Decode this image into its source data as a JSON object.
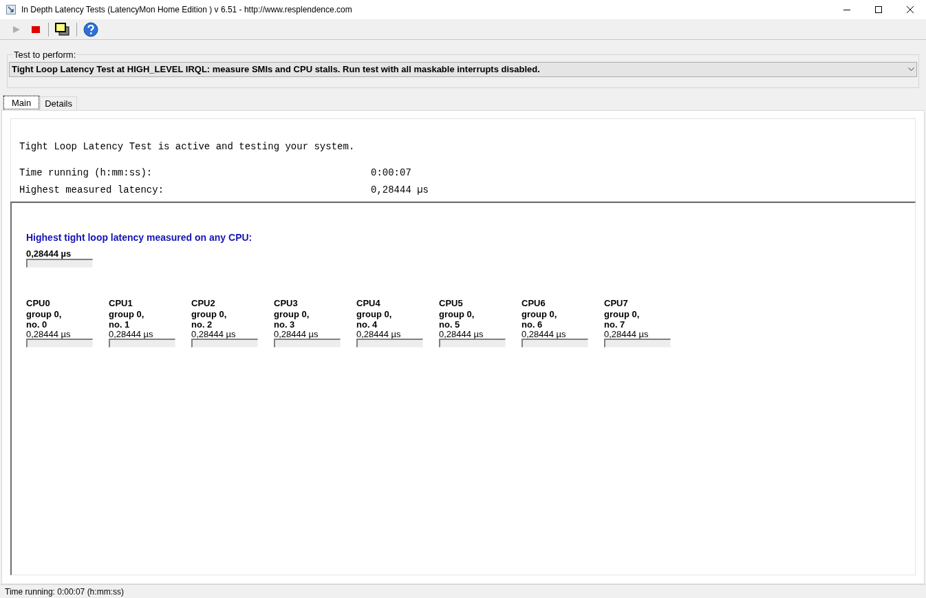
{
  "window": {
    "title": "In Depth Latency Tests  (LatencyMon Home Edition )  v 6.51 - http://www.resplendence.com"
  },
  "toolbar": [
    {
      "kind": "play",
      "disabled": true
    },
    {
      "kind": "stop",
      "disabled": false
    },
    {
      "kind": "windows",
      "disabled": false
    },
    {
      "kind": "help",
      "disabled": false
    }
  ],
  "test_group": {
    "label": "Test to perform:",
    "value": "Tight Loop Latency Test at HIGH_LEVEL IRQL:  measure SMIs and CPU stalls. Run test with all maskable interrupts disabled."
  },
  "tabs": [
    {
      "label": "Main",
      "selected": true
    },
    {
      "label": "Details",
      "selected": false
    }
  ],
  "status_panel": {
    "message": "Tight Loop Latency Test is active and testing your system.",
    "rows": [
      {
        "label": "Time running (h:mm:ss):",
        "value": "0:00:07"
      },
      {
        "label": "Highest measured latency:",
        "value": "0,28444 µs"
      }
    ]
  },
  "overall": {
    "title": "Highest tight loop latency measured on any CPU:",
    "value": "0,28444 µs",
    "level": 0
  },
  "cpus": [
    {
      "name": "CPU0",
      "group": "group 0,",
      "number": "no. 0",
      "value": "0,28444 µs",
      "level": 0
    },
    {
      "name": "CPU1",
      "group": "group 0,",
      "number": "no. 1",
      "value": "0,28444 µs",
      "level": 0
    },
    {
      "name": "CPU2",
      "group": "group 0,",
      "number": "no. 2",
      "value": "0,28444 µs",
      "level": 0
    },
    {
      "name": "CPU3",
      "group": "group 0,",
      "number": "no. 3",
      "value": "0,28444 µs",
      "level": 0
    },
    {
      "name": "CPU4",
      "group": "group 0,",
      "number": "no. 4",
      "value": "0,28444 µs",
      "level": 0
    },
    {
      "name": "CPU5",
      "group": "group 0,",
      "number": "no. 5",
      "value": "0,28444 µs",
      "level": 0
    },
    {
      "name": "CPU6",
      "group": "group 0,",
      "number": "no. 6",
      "value": "0,28444 µs",
      "level": 0
    },
    {
      "name": "CPU7",
      "group": "group 0,",
      "number": "no. 7",
      "value": "0,28444 µs",
      "level": 0
    }
  ],
  "status_bar": "Time running: 0:00:07  (h:mm:ss)"
}
